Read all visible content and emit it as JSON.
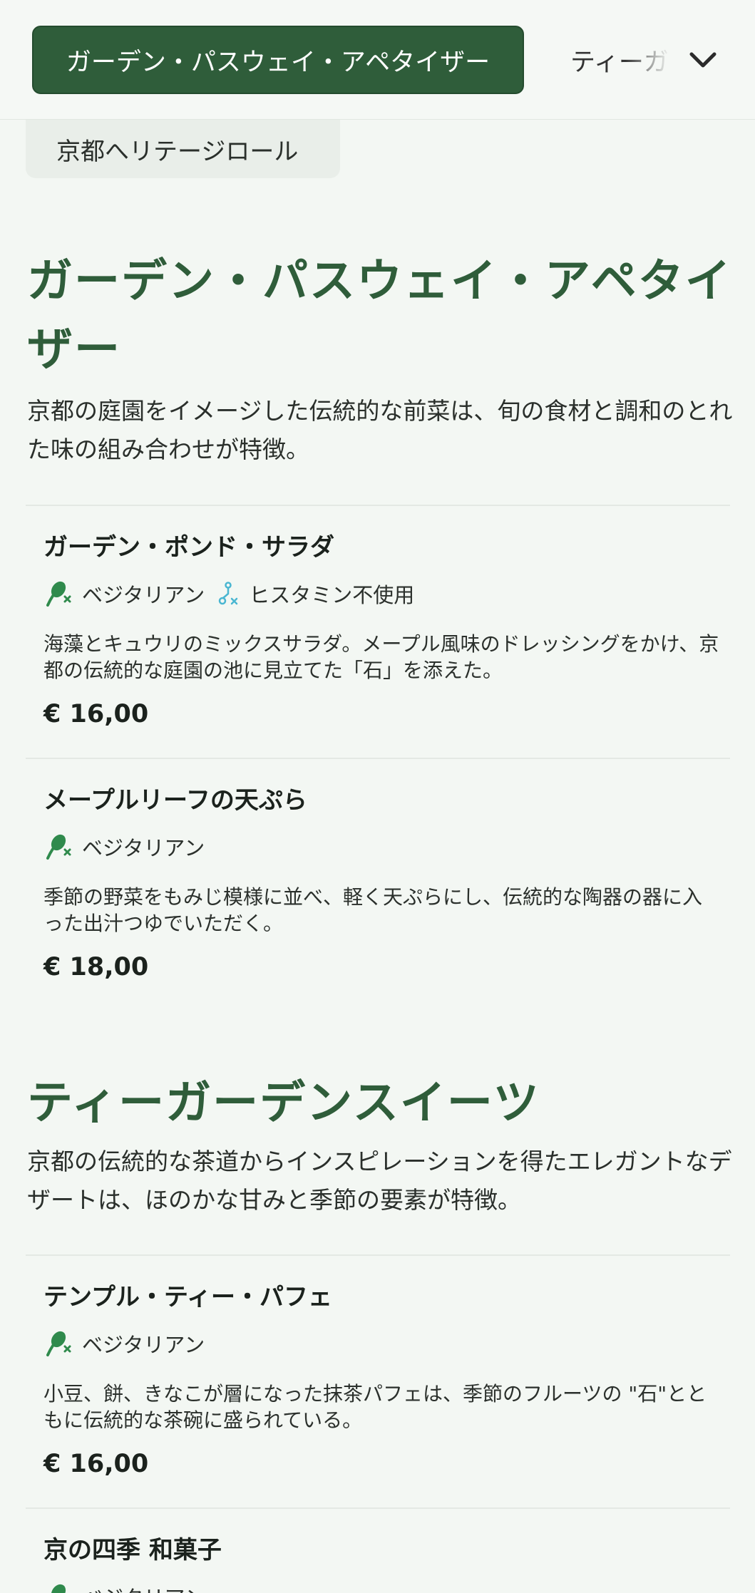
{
  "colors": {
    "accent": "#2f5d3a",
    "background": "#f3f7f3",
    "vegetarian_icon": "#2f8a4c",
    "histamine_icon": "#49b6d1"
  },
  "nav": {
    "active_tab": "ガーデン・パスウェイ・アペタイザー",
    "next_tab": "ティーガ",
    "expand_icon": "chevron-down-icon"
  },
  "chip": {
    "label": "京都へリテージロール"
  },
  "sections": [
    {
      "title": "ガーデン・パスウェイ・アペタイザー",
      "description": "京都の庭園をイメージした伝統的な前菜は、旬の食材と調和のとれた味の組み合わせが特徴。",
      "items": [
        {
          "name": "ガーデン・ポンド・サラダ",
          "tags": [
            "ベジタリアン",
            "ヒスタミン不使用"
          ],
          "description": "海藻とキュウリのミックスサラダ。メープル風味のドレッシングをかけ、京都の伝統的な庭園の池に見立てた「石」を添えた。",
          "price": "€ 16,00"
        },
        {
          "name": "メープルリーフの天ぷら",
          "tags": [
            "ベジタリアン"
          ],
          "description": "季節の野菜をもみじ模様に並べ、軽く天ぷらにし、伝統的な陶器の器に入った出汁つゆでいただく。",
          "price": "€ 18,00"
        }
      ]
    },
    {
      "title": "ティーガーデンスイーツ",
      "description": "京都の伝統的な茶道からインスピレーションを得たエレガントなデザートは、ほのかな甘みと季節の要素が特徴。",
      "items": [
        {
          "name": "テンプル・ティー・パフェ",
          "tags": [
            "ベジタリアン"
          ],
          "description": "小豆、餅、きなこが層になった抹茶パフェは、季節のフルーツの \"石\"とともに伝統的な茶碗に盛られている。",
          "price": "€ 16,00"
        },
        {
          "name": "京の四季 和菓子",
          "tags": [
            "ベジタリアン"
          ]
        }
      ]
    }
  ]
}
